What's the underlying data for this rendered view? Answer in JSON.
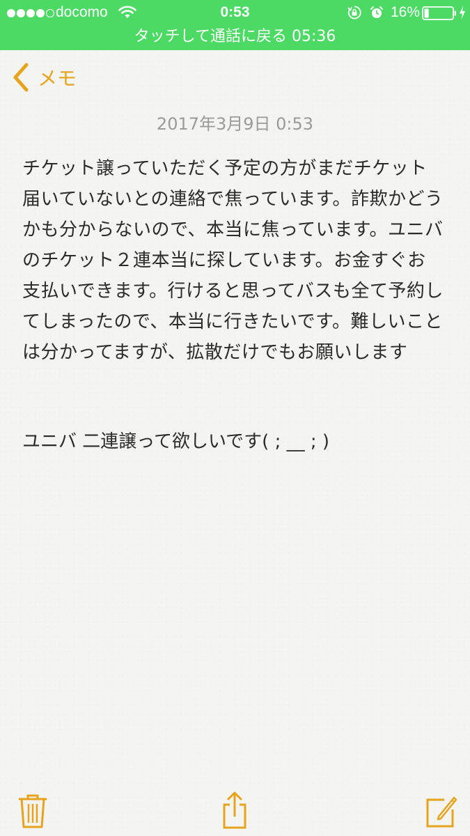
{
  "status_bar": {
    "carrier": "docomo",
    "time": "0:53",
    "battery": "16%",
    "battery_level": 0.16,
    "signal_bars": 4,
    "signal_total": 5,
    "call_banner": "タッチして通話に戻る 05:36",
    "icons": [
      "signal-dots-icon",
      "wifi-icon",
      "rotation-lock-icon",
      "alarm-icon",
      "battery-icon",
      "charging-bolt-icon"
    ]
  },
  "nav": {
    "back_label": "メモ",
    "back_icon": "chevron-left-icon"
  },
  "note": {
    "date": "2017年3月9日 0:53",
    "body": "チケット譲っていただく予定の方がまだチケット届いていないとの連絡で焦っています。詐欺かどうかも分からないので、本当に焦っています。ユニバのチケット２連本当に探しています。お金すぐお支払いできます。行けると思ってバスも全て予約してしまったので、本当に行きたいです。難しいことは分かってますが、拡散だけでもお願いします",
    "second_line": "ユニバ 二連譲って欲しいです( ; __ ; )"
  },
  "toolbar": {
    "items": [
      "trash-icon",
      "share-icon",
      "compose-icon"
    ]
  },
  "colors": {
    "status_bar": "#4cd964",
    "accent": "#e6a31d",
    "date_text": "#9a9a9a",
    "body_text": "#2b2b2b",
    "background": "#f4f4f2"
  }
}
